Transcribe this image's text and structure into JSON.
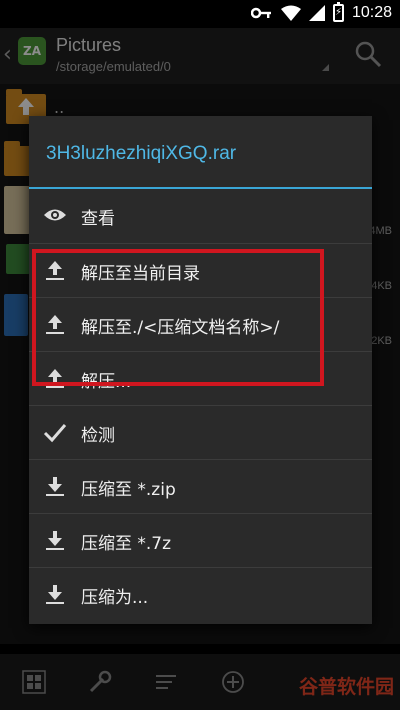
{
  "status": {
    "time": "10:28",
    "icons": [
      "key-icon",
      "wifi-icon",
      "signal-icon",
      "battery-icon"
    ]
  },
  "appbar": {
    "logo": "ZA",
    "title": "Pictures",
    "path": "/storage/emulated/0"
  },
  "filelist": {
    "up_label": "..",
    "sizes": [
      "4MB",
      "4KB",
      "2KB"
    ]
  },
  "dialog": {
    "title": "3H3luzhezhiqiXGQ.rar",
    "accent": "#4fb8e6",
    "items": [
      {
        "label": "查看",
        "icon": "eye-icon"
      },
      {
        "label": "解压至当前目录",
        "icon": "extract-icon"
      },
      {
        "label": "解压至./<压缩文档名称>/",
        "icon": "extract-icon"
      },
      {
        "label": "解压...",
        "icon": "extract-icon"
      },
      {
        "label": "检测",
        "icon": "check-icon"
      },
      {
        "label": "压缩至 *.zip",
        "icon": "compress-icon"
      },
      {
        "label": "压缩至 *.7z",
        "icon": "compress-icon"
      },
      {
        "label": "压缩为...",
        "icon": "compress-icon"
      }
    ]
  },
  "bottombar": {
    "icons": [
      "grid-icon",
      "wrench-icon",
      "menu-lines-icon",
      "add-icon"
    ]
  },
  "watermark": "谷普软件园",
  "highlight_color": "#d0161f"
}
